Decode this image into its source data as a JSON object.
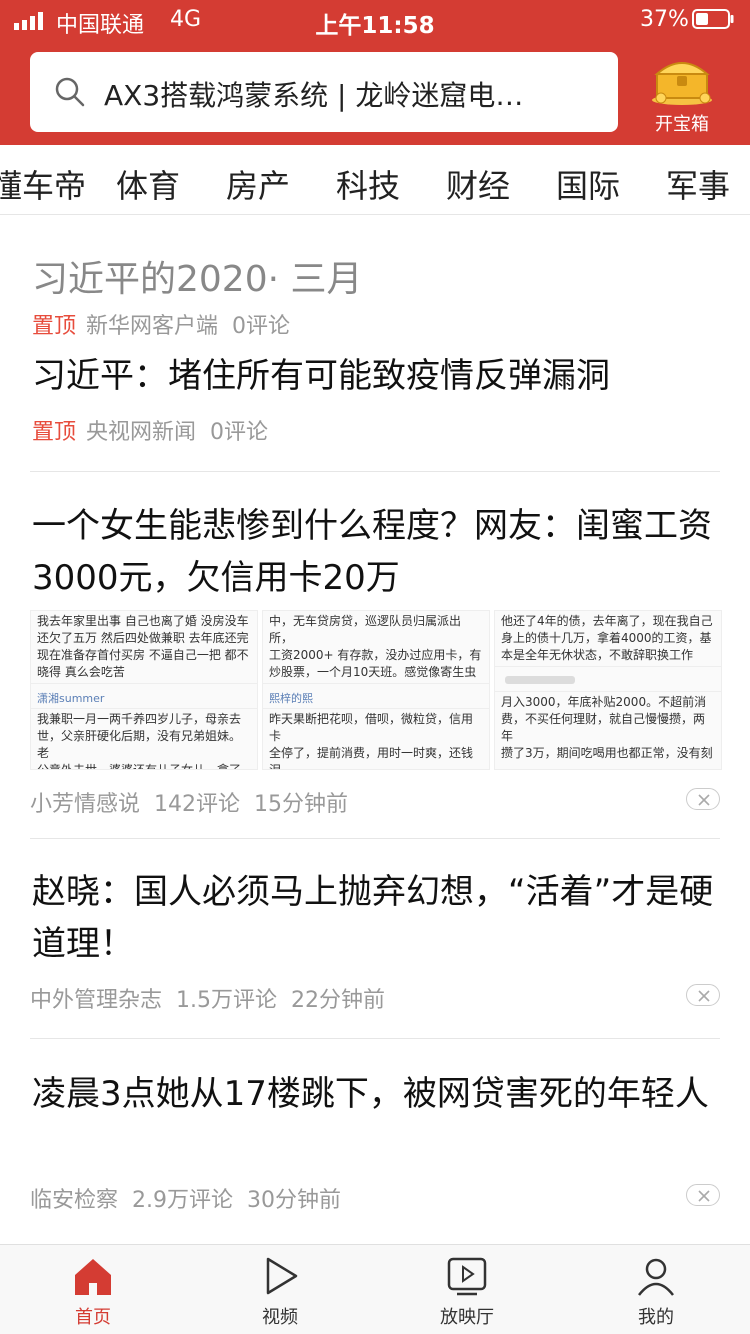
{
  "status_bar": {
    "carrier": "中国联通",
    "network": "4G",
    "time": "上午11:58",
    "battery": "37%"
  },
  "search": {
    "text": "AX3搭载鸿蒙系统 | 龙岭迷窟电…",
    "icon": "search-icon"
  },
  "treasure": {
    "label": "开宝箱",
    "icon": "treasure-chest-icon"
  },
  "tabs": [
    "懂车帝",
    "体育",
    "房产",
    "科技",
    "财经",
    "国际",
    "军事"
  ],
  "feed": {
    "pinned": {
      "title": "习近平的2020· 三月",
      "items": [
        {
          "pin": "置顶",
          "source": "新华网客户端",
          "comments": "0评论"
        }
      ]
    },
    "pinned2": {
      "headline": "习近平：堵住所有可能致疫情反弹漏洞",
      "pin": "置顶",
      "source": "央视网新闻",
      "comments": "0评论"
    },
    "article1": {
      "headline": "一个女生能悲惨到什么程度？网友：闺蜜工资3000元，欠信用卡20万",
      "source": "小芳情感说",
      "comments": "142评论",
      "time": "15分钟前",
      "thumbs": [
        {
          "top": "我去年家里出事 自己也离了婚 没房没车\n还欠了五万 然后四处做兼职 去年底还完\n现在准备存首付买房 不逼自己一把 都不\n晓得 真么会吃苦",
          "user": "潇湘summer",
          "bottom": "我兼职一月一两千养四岁儿子，母亲去\n世，父亲肝硬化后期，没有兄弟姐妹。老\n公意外去世，婆婆还有儿子女儿，拿了钱"
        },
        {
          "top": "中，无车贷房贷，巡逻队员归属派出所，\n工资2000+ 有存款，没办过应用卡，有\n炒股票，一个月10天班。感觉像寄生虫",
          "user": "熙梓的熙",
          "bottom": "昨天果断把花呗，借呗，微粒贷，信用卡\n全停了，提前消费，用时一时爽，还钱泪\n两行，实在不想再这样下去了，有钱就"
        },
        {
          "top": "他还了4年的债，去年离了，现在我自己\n身上的债十几万，拿着4000的工资，基\n本是全年无休状态，不敢辞职换工作",
          "user": "",
          "bottom": "月入3000，年底补贴2000。不超前消\n费，不买任何理财，就自己慢慢攒，两年\n攒了3万，期间吃喝用也都正常，没有刻"
        }
      ]
    },
    "article2": {
      "headline": "赵晓：国人必须马上抛弃幻想，“活着”才是硬道理！",
      "source": "中外管理杂志",
      "comments": "1.5万评论",
      "time": "22分钟前"
    },
    "article3": {
      "headline": "凌晨3点她从17楼跳下，被网贷害死的年轻人",
      "source": "临安检察",
      "comments": "2.9万评论",
      "time": "30分钟前"
    }
  },
  "bottom_nav": [
    {
      "label": "首页",
      "icon": "home-icon",
      "active": true
    },
    {
      "label": "视频",
      "icon": "play-icon",
      "active": false
    },
    {
      "label": "放映厅",
      "icon": "screening-room-icon",
      "active": false
    },
    {
      "label": "我的",
      "icon": "profile-icon",
      "active": false
    }
  ],
  "colors": {
    "brand_red": "#d43c33",
    "pin_red": "#e74c3c",
    "meta_gray": "#999999"
  }
}
